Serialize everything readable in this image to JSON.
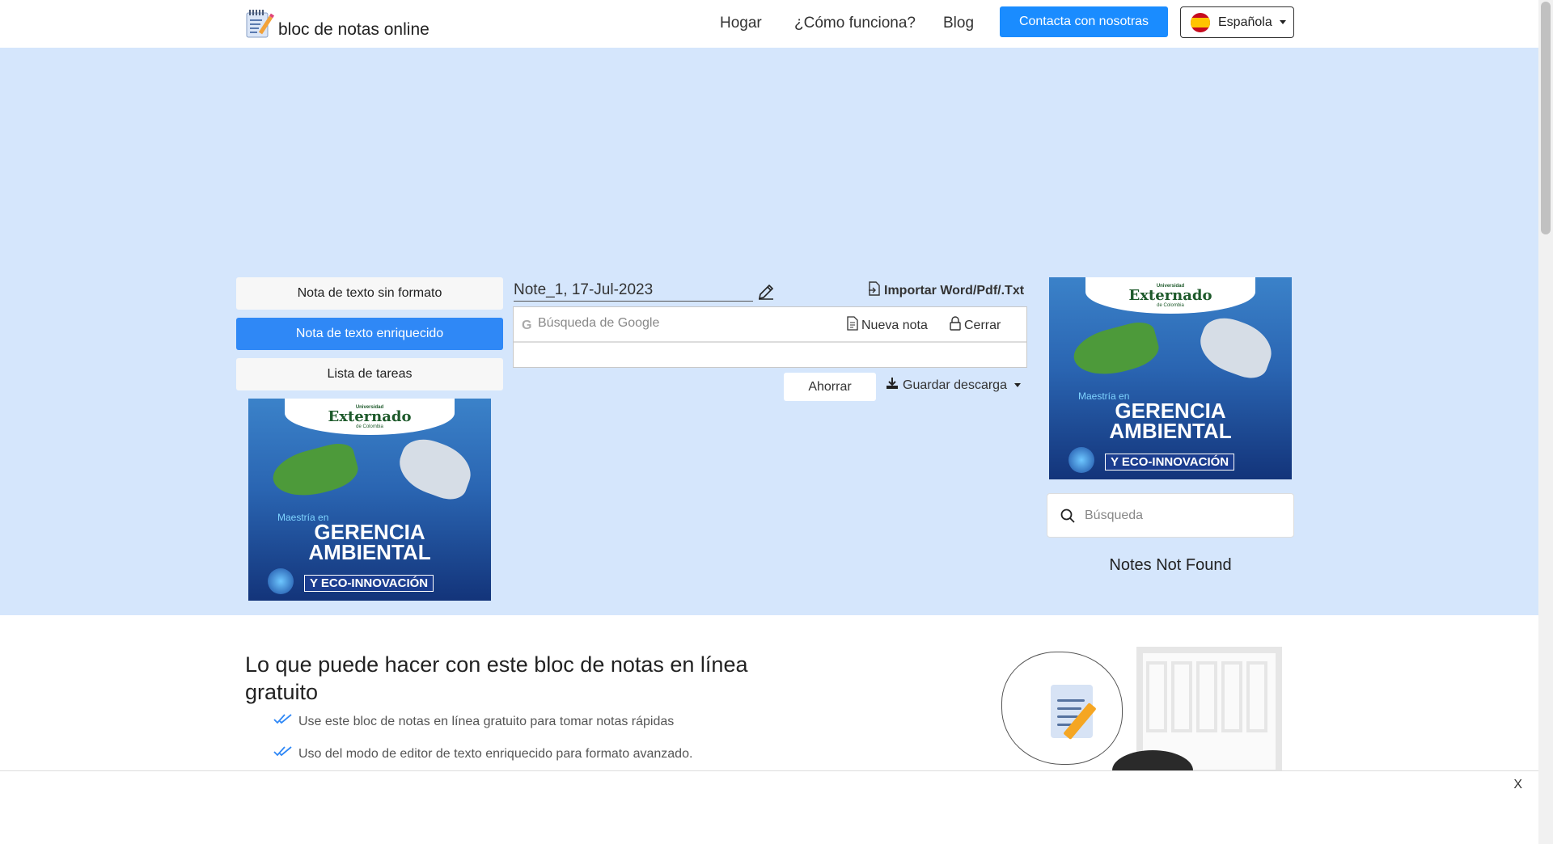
{
  "brand": {
    "name": "bloc de notas online",
    "logo_icon": "notepad-pencil-icon"
  },
  "nav": {
    "links": [
      "Hogar",
      "¿Cómo funciona?",
      "Blog"
    ],
    "contact_button": "Contacta con nosotras",
    "language": {
      "label": "Española",
      "flag_icon": "spain-flag-icon"
    }
  },
  "left_panel": {
    "buttons": [
      "Nota de texto sin formato",
      "Nota de texto enriquecido",
      "Lista de tareas"
    ],
    "active_index": 1
  },
  "ad": {
    "university_small": "Universidad",
    "university_name": "Externado",
    "university_sub": "de Colombia",
    "program_prefix": "Maestría en",
    "program_line1": "GERENCIA",
    "program_line2": "AMBIENTAL",
    "program_line3": "Y ECO-INNOVACIÓN"
  },
  "editor": {
    "note_title": "Note_1, 17-Jul-2023",
    "import_label": "Importar Word/Pdf/.Txt",
    "google_search_placeholder": "Búsqueda de Google",
    "new_note_label": "Nueva nota",
    "lock_label": "Cerrar",
    "save_label": "Ahorrar",
    "download_label": "Guardar descarga"
  },
  "notes_search": {
    "placeholder": "Búsqueda",
    "empty_text": "Notes Not Found"
  },
  "content": {
    "heading": "Lo que puede hacer con este bloc de notas en línea gratuito",
    "features": [
      "Use este bloc de notas en línea gratuito para tomar notas rápidas",
      "Uso del modo de editor de texto enriquecido para formato avanzado."
    ]
  },
  "bottom_ad": {
    "close_label": "X"
  },
  "colors": {
    "primary": "#2f88f6",
    "contact": "#1a8cff",
    "hero_bg": "#d5e6fc"
  }
}
